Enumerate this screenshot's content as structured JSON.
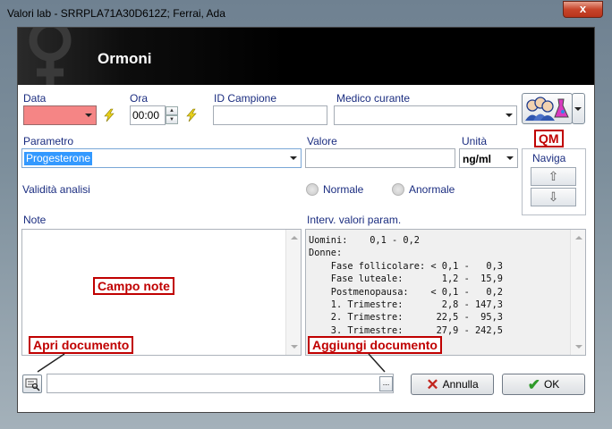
{
  "window": {
    "title": "Valori lab - SRRPLA71A30D612Z; Ferrai, Ada",
    "close_label": "x"
  },
  "header": {
    "title": "Ormoni",
    "icon": "venus-icon"
  },
  "fields": {
    "data_label": "Data",
    "data_value": "",
    "ora_label": "Ora",
    "ora_value": "00:00",
    "id_campione_label": "ID Campione",
    "id_campione_value": "",
    "medico_label": "Medico curante",
    "medico_value": "",
    "parametro_label": "Parametro",
    "parametro_value": "Progesterone",
    "valore_label": "Valore",
    "valore_value": "",
    "unita_label": "Unità",
    "unita_value": "ng/ml"
  },
  "validita": {
    "label": "Validità analisi",
    "options": [
      "Normale",
      "Anormale"
    ]
  },
  "naviga": {
    "label": "Naviga",
    "up": "⇧",
    "down": "⇩"
  },
  "notes": {
    "label": "Note",
    "value": ""
  },
  "ranges": {
    "label": "Interv. valori param.",
    "text": "Uomini:    0,1 - 0,2\nDonne:\n    Fase follicolare: < 0,1 -   0,3\n    Fase luteale:       1,2 -  15,9\n    Postmenopausa:    < 0,1 -   0,2\n    1. Trimestre:       2,8 - 147,3\n    2. Trimestre:      22,5 -  95,3\n    3. Trimestre:      27,9 - 242,5"
  },
  "annotations": {
    "qm": "QM",
    "campo_note": "Campo note",
    "apri_documento": "Apri documento",
    "aggiungi_documento": "Aggiungi documento"
  },
  "document": {
    "path": "",
    "browse_label": "..."
  },
  "buttons": {
    "annulla": "Annulla",
    "ok": "OK"
  },
  "colors": {
    "required_field": "#f58585",
    "annotation": "#c00000",
    "label": "#1b2d80"
  }
}
